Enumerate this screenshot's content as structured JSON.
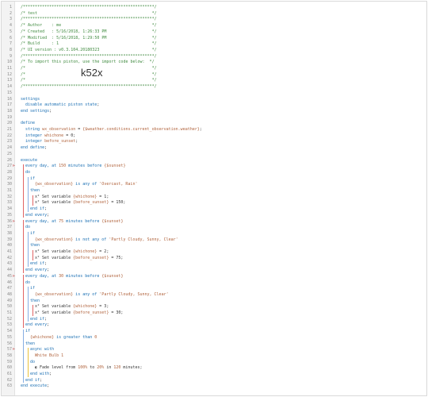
{
  "editor": {
    "lines": [
      {
        "n": "1",
        "indent": 0,
        "parts": [
          {
            "t": "/*******************************************************/",
            "c": "c"
          }
        ]
      },
      {
        "n": "2",
        "indent": 0,
        "parts": [
          {
            "t": "/* test                                                */",
            "c": "c"
          }
        ]
      },
      {
        "n": "3",
        "indent": 0,
        "parts": [
          {
            "t": "/*******************************************************/",
            "c": "c"
          }
        ]
      },
      {
        "n": "4",
        "indent": 0,
        "parts": [
          {
            "t": "/* Author    : me                                      */",
            "c": "c"
          }
        ]
      },
      {
        "n": "5",
        "indent": 0,
        "parts": [
          {
            "t": "/* Created   : 5/16/2018, 1:26:33 PM                   */",
            "c": "c"
          }
        ]
      },
      {
        "n": "6",
        "indent": 0,
        "parts": [
          {
            "t": "/* Modified  : 5/16/2018, 1:29:50 PM                   */",
            "c": "c"
          }
        ]
      },
      {
        "n": "7",
        "indent": 0,
        "parts": [
          {
            "t": "/* Build     : 1                                       */",
            "c": "c"
          }
        ]
      },
      {
        "n": "8",
        "indent": 0,
        "parts": [
          {
            "t": "/* UI version : v0.3.104.20180323                      */",
            "c": "c"
          }
        ]
      },
      {
        "n": "9",
        "indent": 0,
        "parts": [
          {
            "t": "/*******************************************************/",
            "c": "c"
          }
        ]
      },
      {
        "n": "10",
        "indent": 0,
        "parts": [
          {
            "t": "/* To import this piston, use the import code below:  */",
            "c": "c"
          }
        ]
      },
      {
        "n": "11",
        "indent": 0,
        "parts": [
          {
            "t": "/*                                                     */",
            "c": "c"
          }
        ]
      },
      {
        "n": "12",
        "indent": 0,
        "parts": [
          {
            "t": "/*                                                     */",
            "c": "c"
          }
        ],
        "big": "k52x"
      },
      {
        "n": "13",
        "indent": 0,
        "parts": [
          {
            "t": "/*                                                     */",
            "c": "c"
          }
        ]
      },
      {
        "n": "14",
        "indent": 0,
        "parts": [
          {
            "t": "/*******************************************************/",
            "c": "c"
          }
        ]
      },
      {
        "n": "15",
        "indent": 0,
        "parts": []
      },
      {
        "n": "16",
        "indent": 0,
        "parts": [
          {
            "t": "settings",
            "c": "k"
          }
        ]
      },
      {
        "n": "17",
        "indent": 2,
        "parts": [
          {
            "t": "disable automatic piston state",
            "c": "k"
          },
          {
            "t": ";",
            "c": "p"
          }
        ]
      },
      {
        "n": "18",
        "indent": 0,
        "parts": [
          {
            "t": "end settings",
            "c": "k"
          },
          {
            "t": ";",
            "c": "p"
          }
        ]
      },
      {
        "n": "19",
        "indent": 0,
        "parts": []
      },
      {
        "n": "20",
        "indent": 0,
        "parts": [
          {
            "t": "define",
            "c": "k"
          }
        ]
      },
      {
        "n": "21",
        "indent": 2,
        "parts": [
          {
            "t": "string ",
            "c": "k"
          },
          {
            "t": "wx_observation",
            "c": "v"
          },
          {
            "t": " = ",
            "c": "p"
          },
          {
            "t": "{$weather.conditions.current_observation.weather}",
            "c": "s"
          },
          {
            "t": ";",
            "c": "p"
          }
        ]
      },
      {
        "n": "22",
        "indent": 2,
        "parts": [
          {
            "t": "integer ",
            "c": "k"
          },
          {
            "t": "whichone",
            "c": "v"
          },
          {
            "t": " = 0;",
            "c": "p"
          }
        ]
      },
      {
        "n": "23",
        "indent": 2,
        "parts": [
          {
            "t": "integer ",
            "c": "k"
          },
          {
            "t": "before_sunset",
            "c": "v"
          },
          {
            "t": ";",
            "c": "p"
          }
        ]
      },
      {
        "n": "24",
        "indent": 0,
        "parts": [
          {
            "t": "end define",
            "c": "k"
          },
          {
            "t": ";",
            "c": "p"
          }
        ]
      },
      {
        "n": "25",
        "indent": 0,
        "parts": []
      },
      {
        "n": "26",
        "indent": 0,
        "parts": [
          {
            "t": "execute",
            "c": "k"
          }
        ]
      },
      {
        "n": "27",
        "indent": 2,
        "marker": true,
        "parts": [
          {
            "t": "every ",
            "c": "k"
          },
          {
            "t": "day",
            "c": "n"
          },
          {
            "t": ", at ",
            "c": "k"
          },
          {
            "t": "150",
            "c": "s"
          },
          {
            "t": " minutes before ",
            "c": "k"
          },
          {
            "t": "{$sunset}",
            "c": "s"
          }
        ]
      },
      {
        "n": "28",
        "indent": 2,
        "parts": [
          {
            "t": "do",
            "c": "k"
          }
        ]
      },
      {
        "n": "29",
        "indent": 4,
        "parts": [
          {
            "t": "if",
            "c": "k"
          }
        ]
      },
      {
        "n": "30",
        "indent": 6,
        "parts": [
          {
            "t": "{wx_observation}",
            "c": "v"
          },
          {
            "t": " is any of ",
            "c": "k"
          },
          {
            "t": "'Overcast, Rain'",
            "c": "s"
          }
        ]
      },
      {
        "n": "31",
        "indent": 4,
        "parts": [
          {
            "t": "then",
            "c": "k"
          }
        ]
      },
      {
        "n": "32",
        "indent": 6,
        "parts": [
          {
            "t": "x² Set variable ",
            "c": "p"
          },
          {
            "t": "{whichone}",
            "c": "v"
          },
          {
            "t": " = 1;",
            "c": "p"
          }
        ]
      },
      {
        "n": "33",
        "indent": 6,
        "parts": [
          {
            "t": "x² Set variable ",
            "c": "p"
          },
          {
            "t": "{before_sunset}",
            "c": "v"
          },
          {
            "t": " = 150;",
            "c": "p"
          }
        ]
      },
      {
        "n": "34",
        "indent": 4,
        "parts": [
          {
            "t": "end if",
            "c": "k"
          },
          {
            "t": ";",
            "c": "p"
          }
        ]
      },
      {
        "n": "35",
        "indent": 2,
        "parts": [
          {
            "t": "end every",
            "c": "k"
          },
          {
            "t": ";",
            "c": "p"
          }
        ]
      },
      {
        "n": "36",
        "indent": 2,
        "marker": true,
        "parts": [
          {
            "t": "every ",
            "c": "k"
          },
          {
            "t": "day",
            "c": "n"
          },
          {
            "t": ", at ",
            "c": "k"
          },
          {
            "t": "75",
            "c": "s"
          },
          {
            "t": " minutes before ",
            "c": "k"
          },
          {
            "t": "{$sunset}",
            "c": "s"
          }
        ]
      },
      {
        "n": "37",
        "indent": 2,
        "parts": [
          {
            "t": "do",
            "c": "k"
          }
        ]
      },
      {
        "n": "38",
        "indent": 4,
        "parts": [
          {
            "t": "if",
            "c": "k"
          }
        ]
      },
      {
        "n": "39",
        "indent": 6,
        "parts": [
          {
            "t": "{wx_observation}",
            "c": "v"
          },
          {
            "t": " is not any of ",
            "c": "k"
          },
          {
            "t": "'Partly Cloudy, Sunny, Clear'",
            "c": "s"
          }
        ]
      },
      {
        "n": "40",
        "indent": 4,
        "parts": [
          {
            "t": "then",
            "c": "k"
          }
        ]
      },
      {
        "n": "41",
        "indent": 6,
        "parts": [
          {
            "t": "x² Set variable ",
            "c": "p"
          },
          {
            "t": "{whichone}",
            "c": "v"
          },
          {
            "t": " = 2;",
            "c": "p"
          }
        ]
      },
      {
        "n": "42",
        "indent": 6,
        "parts": [
          {
            "t": "x² Set variable ",
            "c": "p"
          },
          {
            "t": "{before_sunset}",
            "c": "v"
          },
          {
            "t": " = 75;",
            "c": "p"
          }
        ]
      },
      {
        "n": "43",
        "indent": 4,
        "parts": [
          {
            "t": "end if",
            "c": "k"
          },
          {
            "t": ";",
            "c": "p"
          }
        ]
      },
      {
        "n": "44",
        "indent": 2,
        "parts": [
          {
            "t": "end every",
            "c": "k"
          },
          {
            "t": ";",
            "c": "p"
          }
        ]
      },
      {
        "n": "45",
        "indent": 2,
        "marker": true,
        "parts": [
          {
            "t": "every ",
            "c": "k"
          },
          {
            "t": "day",
            "c": "n"
          },
          {
            "t": ", at ",
            "c": "k"
          },
          {
            "t": "30",
            "c": "s"
          },
          {
            "t": " minutes before ",
            "c": "k"
          },
          {
            "t": "{$sunset}",
            "c": "s"
          }
        ]
      },
      {
        "n": "46",
        "indent": 2,
        "parts": [
          {
            "t": "do",
            "c": "k"
          }
        ]
      },
      {
        "n": "47",
        "indent": 4,
        "parts": [
          {
            "t": "if",
            "c": "k"
          }
        ]
      },
      {
        "n": "48",
        "indent": 6,
        "parts": [
          {
            "t": "{wx_observation}",
            "c": "v"
          },
          {
            "t": " is any of ",
            "c": "k"
          },
          {
            "t": "'Partly Cloudy, Sunny, Clear'",
            "c": "s"
          }
        ]
      },
      {
        "n": "49",
        "indent": 4,
        "parts": [
          {
            "t": "then",
            "c": "k"
          }
        ]
      },
      {
        "n": "50",
        "indent": 6,
        "parts": [
          {
            "t": "x² Set variable ",
            "c": "p"
          },
          {
            "t": "{whichone}",
            "c": "v"
          },
          {
            "t": " = 3;",
            "c": "p"
          }
        ]
      },
      {
        "n": "51",
        "indent": 6,
        "parts": [
          {
            "t": "x² Set variable ",
            "c": "p"
          },
          {
            "t": "{before_sunset}",
            "c": "v"
          },
          {
            "t": " = 30;",
            "c": "p"
          }
        ]
      },
      {
        "n": "52",
        "indent": 4,
        "parts": [
          {
            "t": "end if",
            "c": "k"
          },
          {
            "t": ";",
            "c": "p"
          }
        ]
      },
      {
        "n": "53",
        "indent": 2,
        "parts": [
          {
            "t": "end every",
            "c": "k"
          },
          {
            "t": ";",
            "c": "p"
          }
        ]
      },
      {
        "n": "54",
        "indent": 2,
        "parts": [
          {
            "t": "if",
            "c": "k"
          }
        ]
      },
      {
        "n": "55",
        "indent": 4,
        "parts": [
          {
            "t": "{whichone}",
            "c": "v"
          },
          {
            "t": " is greater than ",
            "c": "k"
          },
          {
            "t": "0",
            "c": "s"
          }
        ]
      },
      {
        "n": "56",
        "indent": 2,
        "parts": [
          {
            "t": "then",
            "c": "k"
          }
        ]
      },
      {
        "n": "57",
        "indent": 4,
        "marker": true,
        "parts": [
          {
            "t": "async with",
            "c": "k"
          }
        ]
      },
      {
        "n": "58",
        "indent": 6,
        "parts": [
          {
            "t": "White Bulb 1",
            "c": "s"
          }
        ]
      },
      {
        "n": "59",
        "indent": 4,
        "parts": [
          {
            "t": "do",
            "c": "k"
          }
        ]
      },
      {
        "n": "60",
        "indent": 6,
        "parts": [
          {
            "t": "◐ Fade level from ",
            "c": "p"
          },
          {
            "t": "100%",
            "c": "s"
          },
          {
            "t": " to ",
            "c": "p"
          },
          {
            "t": "20%",
            "c": "s"
          },
          {
            "t": " in ",
            "c": "p"
          },
          {
            "t": "120",
            "c": "s"
          },
          {
            "t": " minutes;",
            "c": "p"
          }
        ]
      },
      {
        "n": "61",
        "indent": 4,
        "parts": [
          {
            "t": "end with",
            "c": "k"
          },
          {
            "t": ";",
            "c": "p"
          }
        ]
      },
      {
        "n": "62",
        "indent": 2,
        "parts": [
          {
            "t": "end if",
            "c": "k"
          },
          {
            "t": ";",
            "c": "p"
          }
        ]
      },
      {
        "n": "63",
        "indent": 0,
        "parts": [
          {
            "t": "end execute",
            "c": "k"
          },
          {
            "t": ";",
            "c": "p"
          }
        ]
      }
    ]
  }
}
